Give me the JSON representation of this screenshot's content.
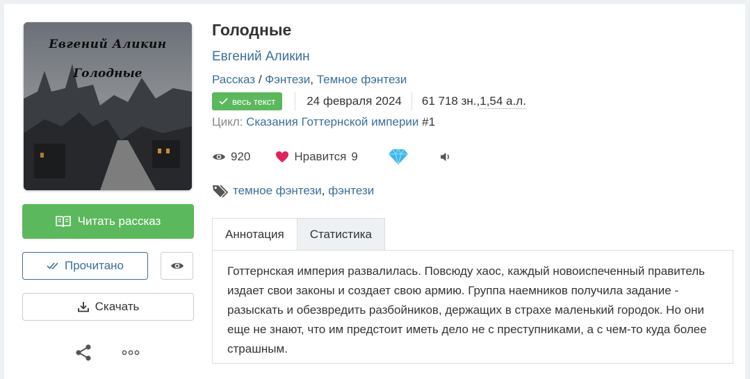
{
  "cover": {
    "author_text": "Евгений Аликин",
    "title_text": "Голодные"
  },
  "actions": {
    "read_label": "Читать рассказ",
    "done_label": "Прочитано",
    "download_label": "Скачать"
  },
  "book": {
    "title": "Голодные",
    "author": "Евгений Аликин",
    "type": "Рассказ",
    "type_sep": " / ",
    "genre1": "Фэнтези",
    "genre_comma": ", ",
    "genre2": "Темное фэнтези",
    "badge": "весь текст",
    "date": "24 февраля 2024",
    "size": "61 718 зн., ",
    "size_al": "1,54 а.л.",
    "cycle_label": "Цикл: ",
    "cycle_name": "Сказания Готтернской империи",
    "cycle_num": " #1"
  },
  "stats": {
    "views": "920",
    "likes_label": "Нравится",
    "likes": "9"
  },
  "tags": {
    "tag1": "темное фэнтези",
    "comma": ",",
    "tag2": "фэнтези"
  },
  "tabs": {
    "annotation": "Аннотация",
    "statistics": "Статистика"
  },
  "annotation": {
    "text": "Готтернская империя развалилась. Повсюду хаос, каждый новоиспеченный правитель издает свои законы и создает свою армию. Группа наемников получила задание - разыскать и обезвредить разбойников, держащих в страхе маленький городок. Но они еще не знают, что им предстоит иметь дело не с преступниками, а с чем-то куда более страшным."
  },
  "colors": {
    "accent_green": "#5cb85c",
    "link_blue": "#3a6f9a",
    "heart_red": "#e0245e",
    "diamond": "#3fb6e8"
  },
  "icons": [
    "book-icon",
    "check-double-icon",
    "eye-icon",
    "download-icon",
    "share-icon",
    "more-icon",
    "check-icon",
    "views-eye-icon",
    "heart-icon",
    "diamond-icon",
    "speaker-icon",
    "tags-icon"
  ]
}
